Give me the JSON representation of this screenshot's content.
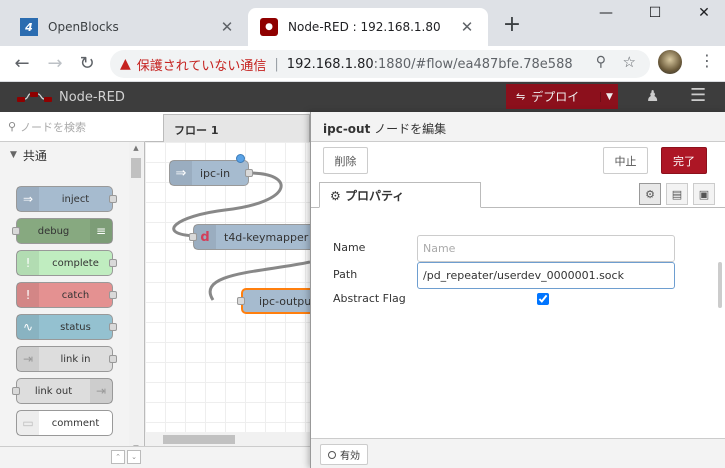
{
  "browser": {
    "tabs": [
      {
        "title": "OpenBlocks",
        "favicon": "4"
      },
      {
        "title": "Node-RED : 192.168.1.80",
        "favicon": "nr"
      }
    ],
    "new_tab": "+",
    "window_controls": {
      "minimize": "—",
      "maximize": "☐",
      "close": "✕"
    },
    "address": {
      "warning_label": "保護されていない通信",
      "host": "192.168.1.80",
      "path": ":1880/#flow/ea487bfe.78e588"
    }
  },
  "header": {
    "app_name": "Node-RED",
    "deploy_label": "デプロイ"
  },
  "palette": {
    "search_placeholder": "ノードを検索",
    "category": "共通",
    "nodes": [
      {
        "label": "inject",
        "icon": "inject-icon",
        "color": "#a6bbcf"
      },
      {
        "label": "debug",
        "icon": "debug-icon",
        "color": "#87a980"
      },
      {
        "label": "complete",
        "icon": "complete-icon",
        "color": "#c0deed"
      },
      {
        "label": "catch",
        "icon": "catch-icon",
        "color": "#e49191"
      },
      {
        "label": "status",
        "icon": "status-icon",
        "color": "#94c1d0"
      },
      {
        "label": "link in",
        "icon": "link-in-icon",
        "color": "#dddddd"
      },
      {
        "label": "link out",
        "icon": "link-out-icon",
        "color": "#dddddd"
      },
      {
        "label": "comment",
        "icon": "comment-icon",
        "color": "#ffffff"
      }
    ]
  },
  "workspace": {
    "tab_label": "フロー 1",
    "nodes": [
      {
        "label": "ipc-in",
        "color": "#a6bbcf"
      },
      {
        "label": "t4d-keymapper",
        "color": "#a6bbcf"
      },
      {
        "label": "ipc-output",
        "color": "#a6bbcf"
      }
    ]
  },
  "tray": {
    "title_node": "ipc-out",
    "title_suffix": " ノードを編集",
    "delete_label": "削除",
    "cancel_label": "中止",
    "done_label": "完了",
    "tab_label": "プロパティ",
    "fields": {
      "name_label": "Name",
      "name_value": "",
      "name_placeholder": "Name",
      "path_label": "Path",
      "path_value": "/pd_repeater/userdev_0000001.sock",
      "flag_label": "Abstract Flag",
      "flag_checked": true
    },
    "enabled_label": "有効"
  },
  "colors": {
    "deploy": "#8c101c",
    "done": "#ad1625",
    "header": "#3d3d3d"
  }
}
